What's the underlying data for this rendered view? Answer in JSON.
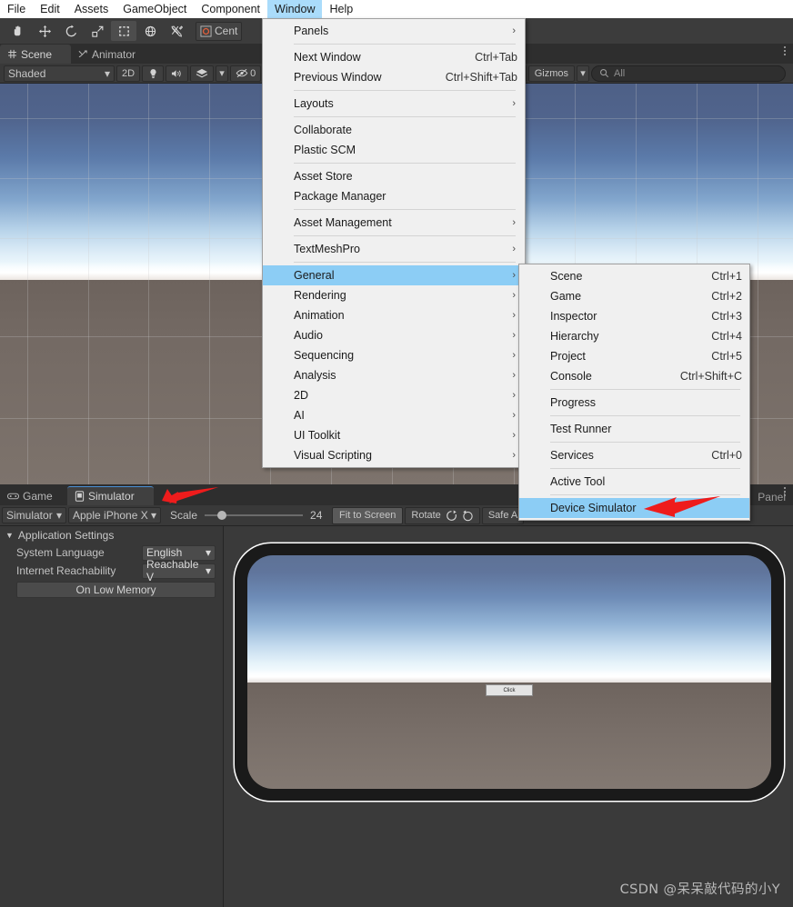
{
  "menubar": {
    "items": [
      {
        "label": "File",
        "active": false
      },
      {
        "label": "Edit",
        "active": false
      },
      {
        "label": "Assets",
        "active": false
      },
      {
        "label": "GameObject",
        "active": false
      },
      {
        "label": "Component",
        "active": false
      },
      {
        "label": "Window",
        "active": true
      },
      {
        "label": "Help",
        "active": false
      }
    ]
  },
  "toolbar": {
    "tools": [
      "hand-tool",
      "move-tool",
      "rotate-tool",
      "scale-tool",
      "rect-tool",
      "transform-tool",
      "custom-tool"
    ],
    "pivot_label": "Cent"
  },
  "scene": {
    "tabs": [
      {
        "label": "Scene",
        "icon": "scene-icon",
        "selected": true
      },
      {
        "label": "Animator",
        "icon": "animator-icon",
        "selected": false
      }
    ],
    "shading_mode": "Shaded",
    "mode_2d": "2D",
    "hidden_count": "0",
    "gizmos_label": "Gizmos",
    "search_placeholder": "All",
    "search_value": "All"
  },
  "window_menu": {
    "rows": [
      {
        "label": "Panels",
        "shortcut": "",
        "submenu": true,
        "selected": false
      },
      {
        "sep": true
      },
      {
        "label": "Next Window",
        "shortcut": "Ctrl+Tab",
        "submenu": false,
        "selected": false
      },
      {
        "label": "Previous Window",
        "shortcut": "Ctrl+Shift+Tab",
        "submenu": false,
        "selected": false
      },
      {
        "sep": true
      },
      {
        "label": "Layouts",
        "shortcut": "",
        "submenu": true,
        "selected": false
      },
      {
        "sep": true
      },
      {
        "label": "Collaborate",
        "shortcut": "",
        "submenu": false,
        "selected": false
      },
      {
        "label": "Plastic SCM",
        "shortcut": "",
        "submenu": false,
        "selected": false
      },
      {
        "sep": true
      },
      {
        "label": "Asset Store",
        "shortcut": "",
        "submenu": false,
        "selected": false
      },
      {
        "label": "Package Manager",
        "shortcut": "",
        "submenu": false,
        "selected": false
      },
      {
        "sep": true
      },
      {
        "label": "Asset Management",
        "shortcut": "",
        "submenu": true,
        "selected": false
      },
      {
        "sep": true
      },
      {
        "label": "TextMeshPro",
        "shortcut": "",
        "submenu": true,
        "selected": false
      },
      {
        "sep": true
      },
      {
        "label": "General",
        "shortcut": "",
        "submenu": true,
        "selected": true
      },
      {
        "label": "Rendering",
        "shortcut": "",
        "submenu": true,
        "selected": false
      },
      {
        "label": "Animation",
        "shortcut": "",
        "submenu": true,
        "selected": false
      },
      {
        "label": "Audio",
        "shortcut": "",
        "submenu": true,
        "selected": false
      },
      {
        "label": "Sequencing",
        "shortcut": "",
        "submenu": true,
        "selected": false
      },
      {
        "label": "Analysis",
        "shortcut": "",
        "submenu": true,
        "selected": false
      },
      {
        "label": "2D",
        "shortcut": "",
        "submenu": true,
        "selected": false
      },
      {
        "label": "AI",
        "shortcut": "",
        "submenu": true,
        "selected": false
      },
      {
        "label": "UI Toolkit",
        "shortcut": "",
        "submenu": true,
        "selected": false
      },
      {
        "label": "Visual Scripting",
        "shortcut": "",
        "submenu": true,
        "selected": false
      }
    ]
  },
  "general_submenu": {
    "rows": [
      {
        "label": "Scene",
        "shortcut": "Ctrl+1",
        "selected": false
      },
      {
        "label": "Game",
        "shortcut": "Ctrl+2",
        "selected": false
      },
      {
        "label": "Inspector",
        "shortcut": "Ctrl+3",
        "selected": false
      },
      {
        "label": "Hierarchy",
        "shortcut": "Ctrl+4",
        "selected": false
      },
      {
        "label": "Project",
        "shortcut": "Ctrl+5",
        "selected": false
      },
      {
        "label": "Console",
        "shortcut": "Ctrl+Shift+C",
        "selected": false
      },
      {
        "sep": true
      },
      {
        "label": "Progress",
        "shortcut": "",
        "selected": false
      },
      {
        "sep": true
      },
      {
        "label": "Test Runner",
        "shortcut": "",
        "selected": false
      },
      {
        "sep": true
      },
      {
        "label": "Services",
        "shortcut": "Ctrl+0",
        "selected": false
      },
      {
        "sep": true
      },
      {
        "label": "Active Tool",
        "shortcut": "",
        "selected": false
      },
      {
        "sep": true
      },
      {
        "label": "Device Simulator",
        "shortcut": "",
        "selected": true
      }
    ]
  },
  "bottom_panel": {
    "tabs": [
      {
        "label": "Game",
        "icon": "gamepad-icon",
        "selected": false
      },
      {
        "label": "Simulator",
        "icon": "device-icon",
        "selected": true
      }
    ],
    "panel_label": "Panel",
    "simulator_toolbar": {
      "mode": "Simulator",
      "device": "Apple iPhone X",
      "scale_label": "Scale",
      "scale_value": "24",
      "fit_to_screen": "Fit to Screen",
      "rotate_label": "Rotate",
      "safe_area": "Safe A"
    },
    "settings": {
      "foldout_title": "Application Settings",
      "rows": [
        {
          "label": "System Language",
          "value": "English"
        },
        {
          "label": "Internet Reachability",
          "value": "Reachable V"
        }
      ],
      "button": "On Low Memory"
    },
    "device_button_label": "Click"
  },
  "watermark": "CSDN @呆呆敲代码的小Y",
  "colors": {
    "menu_highlight": "#8ccdf5",
    "menubar_highlight": "#aadcfb",
    "arrow_red": "#ee1c1c",
    "panel_bg": "#383838",
    "toolbar_bg": "#3c3c3c"
  }
}
